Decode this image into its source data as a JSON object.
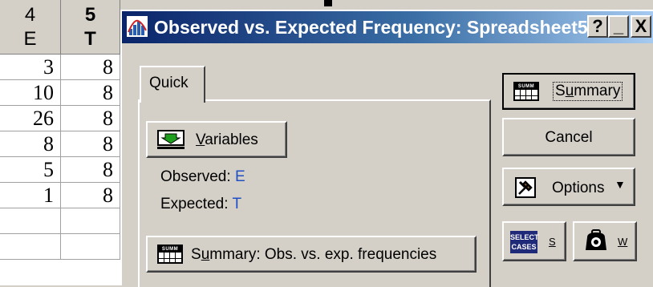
{
  "spreadsheet": {
    "columns": [
      {
        "number": "4",
        "name": "E"
      },
      {
        "number": "5",
        "name": "T"
      }
    ],
    "rows": [
      [
        "3",
        "8"
      ],
      [
        "10",
        "8"
      ],
      [
        "26",
        "8"
      ],
      [
        "8",
        "8"
      ],
      [
        "5",
        "8"
      ],
      [
        "1",
        "8"
      ],
      [
        "",
        ""
      ],
      [
        "",
        ""
      ]
    ]
  },
  "dialog": {
    "title": "Observed vs. Expected Frequency: Spreadsheet5",
    "title_buttons": {
      "help": "?",
      "minimize": "_",
      "close": "X"
    },
    "tab_label": "Quick",
    "variables_button": {
      "mnemonic": "V",
      "rest": "ariables"
    },
    "observed_label": "Observed:",
    "observed_value": "E",
    "expected_label": "Expected:",
    "expected_value": "T",
    "summary_freq_button": {
      "pre": "S",
      "mnemonic": "u",
      "rest": "mmary:  Obs. vs. exp. frequencies"
    },
    "summary_button": {
      "pre": "S",
      "mnemonic": "u",
      "rest": "mmary"
    },
    "cancel_button": "Cancel",
    "options_button": "Options",
    "select_cases_button": {
      "icon_text_1": "SELECT",
      "icon_text_2": "CASES",
      "key": "S"
    },
    "weight_button": {
      "key": "W"
    },
    "summ_icon_text": "SUMM"
  },
  "colors": {
    "title_gradient_start": "#0a246a",
    "title_gradient_end": "#a6caf0",
    "variable_value": "#1f4fc4",
    "face": "#d4d0c8"
  },
  "icons": {
    "title": "histogram-chart-icon",
    "variables": "green-arrow-variables-icon",
    "summary": "spreadsheet-grid-icon",
    "options": "tools-icon",
    "weight": "weight-icon"
  }
}
